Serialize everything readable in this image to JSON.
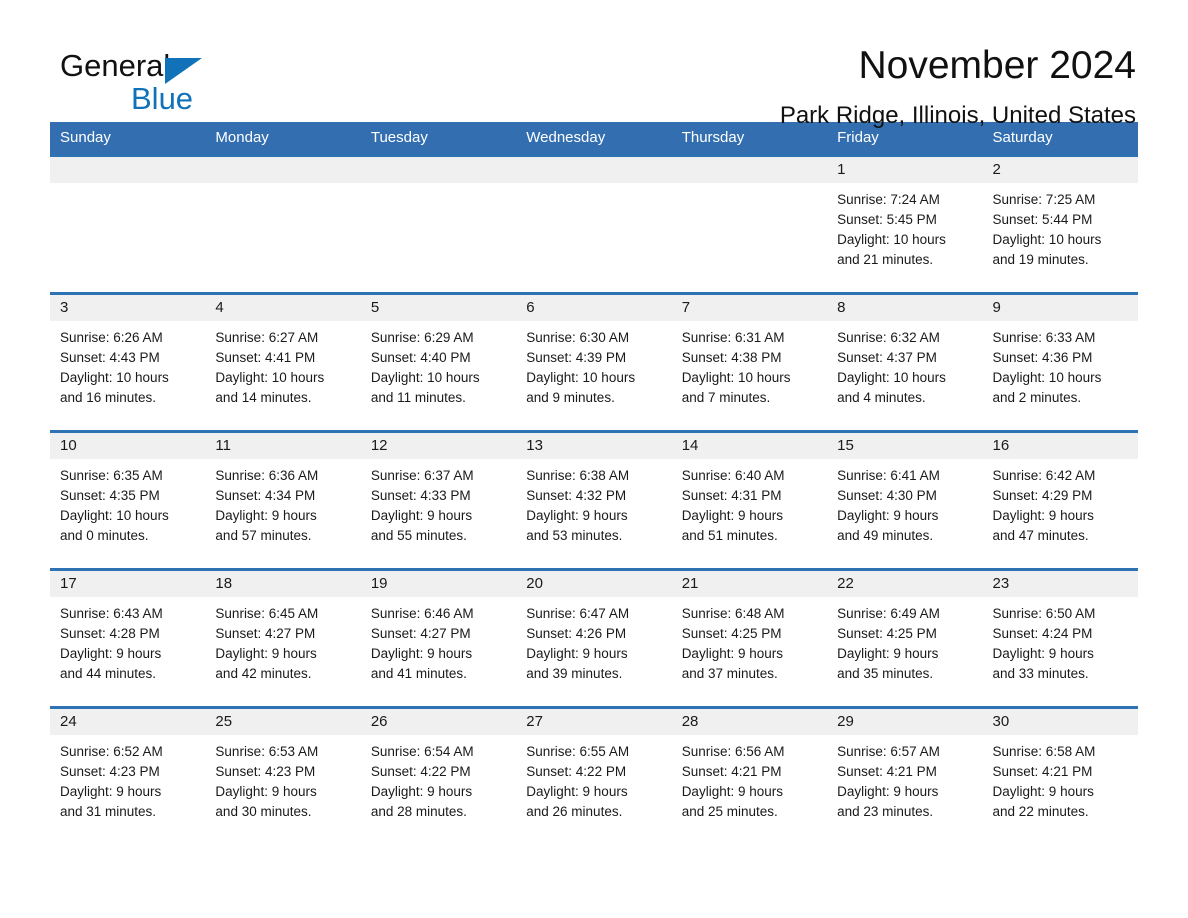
{
  "brand": {
    "name_part1": "General",
    "name_part2": "Blue",
    "logo_icon": "triangle-icon",
    "accent_color": "#1172ba"
  },
  "header": {
    "title": "November 2024",
    "subtitle": "Park Ridge, Illinois, United States"
  },
  "calendar": {
    "header_bg": "#336fb0",
    "row_border_color": "#2f72b3",
    "daynum_bg": "#f0f0f0",
    "weekday_headers": [
      "Sunday",
      "Monday",
      "Tuesday",
      "Wednesday",
      "Thursday",
      "Friday",
      "Saturday"
    ],
    "weeks": [
      [
        {
          "day": "",
          "lines": []
        },
        {
          "day": "",
          "lines": []
        },
        {
          "day": "",
          "lines": []
        },
        {
          "day": "",
          "lines": []
        },
        {
          "day": "",
          "lines": []
        },
        {
          "day": "1",
          "lines": [
            "Sunrise: 7:24 AM",
            "Sunset: 5:45 PM",
            "Daylight: 10 hours",
            "and 21 minutes."
          ]
        },
        {
          "day": "2",
          "lines": [
            "Sunrise: 7:25 AM",
            "Sunset: 5:44 PM",
            "Daylight: 10 hours",
            "and 19 minutes."
          ]
        }
      ],
      [
        {
          "day": "3",
          "lines": [
            "Sunrise: 6:26 AM",
            "Sunset: 4:43 PM",
            "Daylight: 10 hours",
            "and 16 minutes."
          ]
        },
        {
          "day": "4",
          "lines": [
            "Sunrise: 6:27 AM",
            "Sunset: 4:41 PM",
            "Daylight: 10 hours",
            "and 14 minutes."
          ]
        },
        {
          "day": "5",
          "lines": [
            "Sunrise: 6:29 AM",
            "Sunset: 4:40 PM",
            "Daylight: 10 hours",
            "and 11 minutes."
          ]
        },
        {
          "day": "6",
          "lines": [
            "Sunrise: 6:30 AM",
            "Sunset: 4:39 PM",
            "Daylight: 10 hours",
            "and 9 minutes."
          ]
        },
        {
          "day": "7",
          "lines": [
            "Sunrise: 6:31 AM",
            "Sunset: 4:38 PM",
            "Daylight: 10 hours",
            "and 7 minutes."
          ]
        },
        {
          "day": "8",
          "lines": [
            "Sunrise: 6:32 AM",
            "Sunset: 4:37 PM",
            "Daylight: 10 hours",
            "and 4 minutes."
          ]
        },
        {
          "day": "9",
          "lines": [
            "Sunrise: 6:33 AM",
            "Sunset: 4:36 PM",
            "Daylight: 10 hours",
            "and 2 minutes."
          ]
        }
      ],
      [
        {
          "day": "10",
          "lines": [
            "Sunrise: 6:35 AM",
            "Sunset: 4:35 PM",
            "Daylight: 10 hours",
            "and 0 minutes."
          ]
        },
        {
          "day": "11",
          "lines": [
            "Sunrise: 6:36 AM",
            "Sunset: 4:34 PM",
            "Daylight: 9 hours",
            "and 57 minutes."
          ]
        },
        {
          "day": "12",
          "lines": [
            "Sunrise: 6:37 AM",
            "Sunset: 4:33 PM",
            "Daylight: 9 hours",
            "and 55 minutes."
          ]
        },
        {
          "day": "13",
          "lines": [
            "Sunrise: 6:38 AM",
            "Sunset: 4:32 PM",
            "Daylight: 9 hours",
            "and 53 minutes."
          ]
        },
        {
          "day": "14",
          "lines": [
            "Sunrise: 6:40 AM",
            "Sunset: 4:31 PM",
            "Daylight: 9 hours",
            "and 51 minutes."
          ]
        },
        {
          "day": "15",
          "lines": [
            "Sunrise: 6:41 AM",
            "Sunset: 4:30 PM",
            "Daylight: 9 hours",
            "and 49 minutes."
          ]
        },
        {
          "day": "16",
          "lines": [
            "Sunrise: 6:42 AM",
            "Sunset: 4:29 PM",
            "Daylight: 9 hours",
            "and 47 minutes."
          ]
        }
      ],
      [
        {
          "day": "17",
          "lines": [
            "Sunrise: 6:43 AM",
            "Sunset: 4:28 PM",
            "Daylight: 9 hours",
            "and 44 minutes."
          ]
        },
        {
          "day": "18",
          "lines": [
            "Sunrise: 6:45 AM",
            "Sunset: 4:27 PM",
            "Daylight: 9 hours",
            "and 42 minutes."
          ]
        },
        {
          "day": "19",
          "lines": [
            "Sunrise: 6:46 AM",
            "Sunset: 4:27 PM",
            "Daylight: 9 hours",
            "and 41 minutes."
          ]
        },
        {
          "day": "20",
          "lines": [
            "Sunrise: 6:47 AM",
            "Sunset: 4:26 PM",
            "Daylight: 9 hours",
            "and 39 minutes."
          ]
        },
        {
          "day": "21",
          "lines": [
            "Sunrise: 6:48 AM",
            "Sunset: 4:25 PM",
            "Daylight: 9 hours",
            "and 37 minutes."
          ]
        },
        {
          "day": "22",
          "lines": [
            "Sunrise: 6:49 AM",
            "Sunset: 4:25 PM",
            "Daylight: 9 hours",
            "and 35 minutes."
          ]
        },
        {
          "day": "23",
          "lines": [
            "Sunrise: 6:50 AM",
            "Sunset: 4:24 PM",
            "Daylight: 9 hours",
            "and 33 minutes."
          ]
        }
      ],
      [
        {
          "day": "24",
          "lines": [
            "Sunrise: 6:52 AM",
            "Sunset: 4:23 PM",
            "Daylight: 9 hours",
            "and 31 minutes."
          ]
        },
        {
          "day": "25",
          "lines": [
            "Sunrise: 6:53 AM",
            "Sunset: 4:23 PM",
            "Daylight: 9 hours",
            "and 30 minutes."
          ]
        },
        {
          "day": "26",
          "lines": [
            "Sunrise: 6:54 AM",
            "Sunset: 4:22 PM",
            "Daylight: 9 hours",
            "and 28 minutes."
          ]
        },
        {
          "day": "27",
          "lines": [
            "Sunrise: 6:55 AM",
            "Sunset: 4:22 PM",
            "Daylight: 9 hours",
            "and 26 minutes."
          ]
        },
        {
          "day": "28",
          "lines": [
            "Sunrise: 6:56 AM",
            "Sunset: 4:21 PM",
            "Daylight: 9 hours",
            "and 25 minutes."
          ]
        },
        {
          "day": "29",
          "lines": [
            "Sunrise: 6:57 AM",
            "Sunset: 4:21 PM",
            "Daylight: 9 hours",
            "and 23 minutes."
          ]
        },
        {
          "day": "30",
          "lines": [
            "Sunrise: 6:58 AM",
            "Sunset: 4:21 PM",
            "Daylight: 9 hours",
            "and 22 minutes."
          ]
        }
      ]
    ]
  }
}
